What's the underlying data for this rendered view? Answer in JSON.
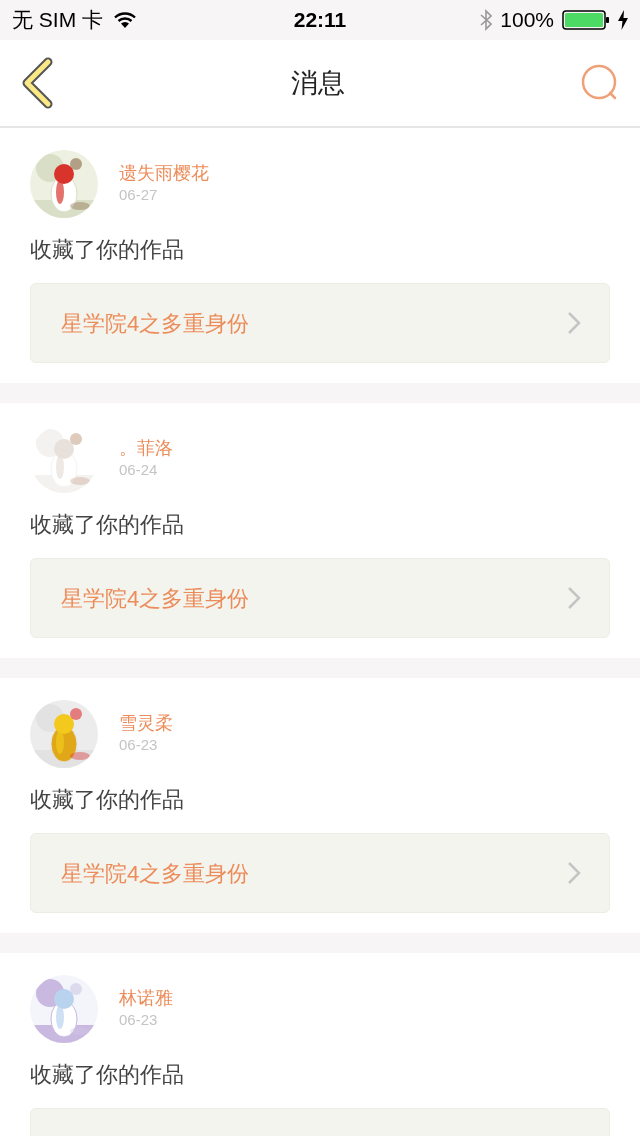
{
  "status_bar": {
    "carrier": "无 SIM 卡",
    "time": "22:11",
    "battery": "100%"
  },
  "nav": {
    "title": "消息"
  },
  "messages": [
    {
      "user": "遗失雨樱花",
      "date": "06-27",
      "action": "收藏了你的作品",
      "work": "星学院4之多重身份"
    },
    {
      "user": "。菲洛",
      "date": "06-24",
      "action": "收藏了你的作品",
      "work": "星学院4之多重身份"
    },
    {
      "user": "雪灵柔",
      "date": "06-23",
      "action": "收藏了你的作品",
      "work": "星学院4之多重身份"
    },
    {
      "user": "林诺雅",
      "date": "06-23",
      "action": "收藏了你的作品",
      "work_cut": true
    }
  ]
}
